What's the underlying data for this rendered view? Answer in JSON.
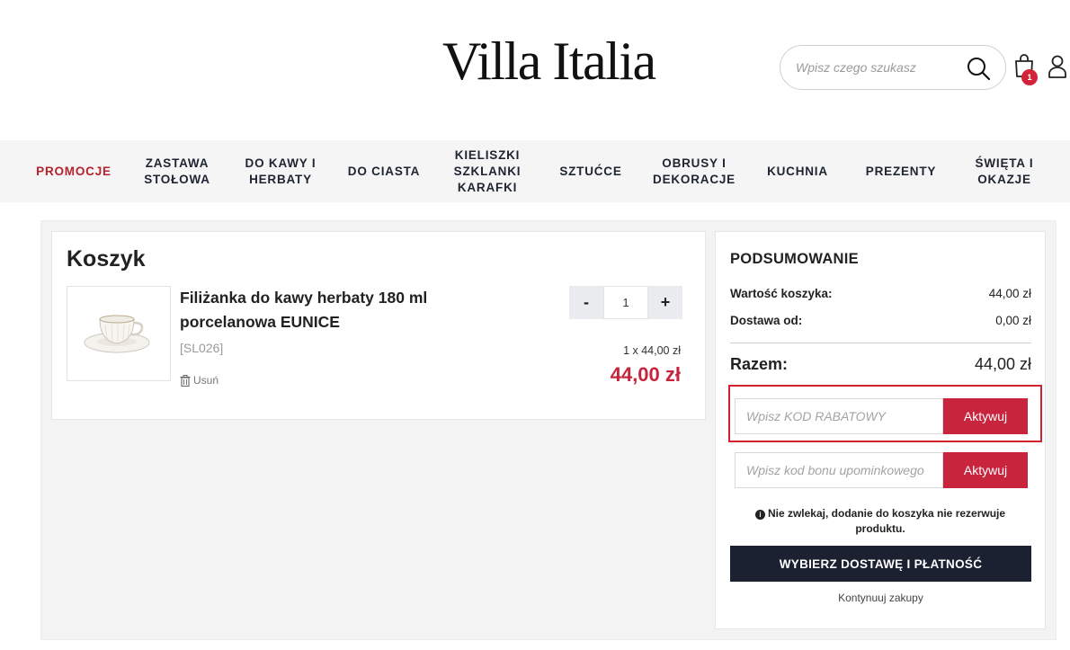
{
  "header": {
    "logo": "Villa Italia",
    "search_placeholder": "Wpisz czego szukasz",
    "cart_count": "1"
  },
  "nav": {
    "items": [
      {
        "label": "PROMOCJE"
      },
      {
        "label": "ZASTAWA\nSTOŁOWA"
      },
      {
        "label": "DO KAWY I\nHERBATY"
      },
      {
        "label": "DO CIASTA"
      },
      {
        "label": "KIELISZKI\nSZKLANKI\nKARAFKI"
      },
      {
        "label": "SZTUĆCE"
      },
      {
        "label": "OBRUSY I\nDEKORACJE"
      },
      {
        "label": "KUCHNIA"
      },
      {
        "label": "PREZENTY"
      },
      {
        "label": "ŚWIĘTA I\nOKAZJE"
      }
    ]
  },
  "cart": {
    "title": "Koszyk",
    "item": {
      "name": "Filiżanka do kawy herbaty 180 ml porcelanowa EUNICE",
      "sku": "[SL026]",
      "remove_label": "Usuń",
      "qty": "1",
      "minus": "-",
      "plus": "+",
      "unit_price": "1 x 44,00 zł",
      "total": "44,00 zł"
    }
  },
  "summary": {
    "title": "PODSUMOWANIE",
    "cart_value_label": "Wartość koszyka:",
    "cart_value": "44,00 zł",
    "delivery_label": "Dostawa od:",
    "delivery_value": "0,00 zł",
    "total_label": "Razem:",
    "total_value": "44,00 zł",
    "discount_placeholder": "Wpisz KOD RABATOWY",
    "discount_button": "Aktywuj",
    "gift_placeholder": "Wpisz kod bonu upominkowego",
    "gift_button": "Aktywuj",
    "notice": "Nie zwlekaj, dodanie do koszyka nie rezerwuje produktu.",
    "checkout_button": "WYBIERZ DOSTAWĘ I PŁATNOŚĆ",
    "continue_link": "Kontynuuj zakupy"
  },
  "colors": {
    "accent": "#c8243d",
    "promo": "#b5232e",
    "dark": "#1b2131",
    "highlight": "#d0212e"
  }
}
